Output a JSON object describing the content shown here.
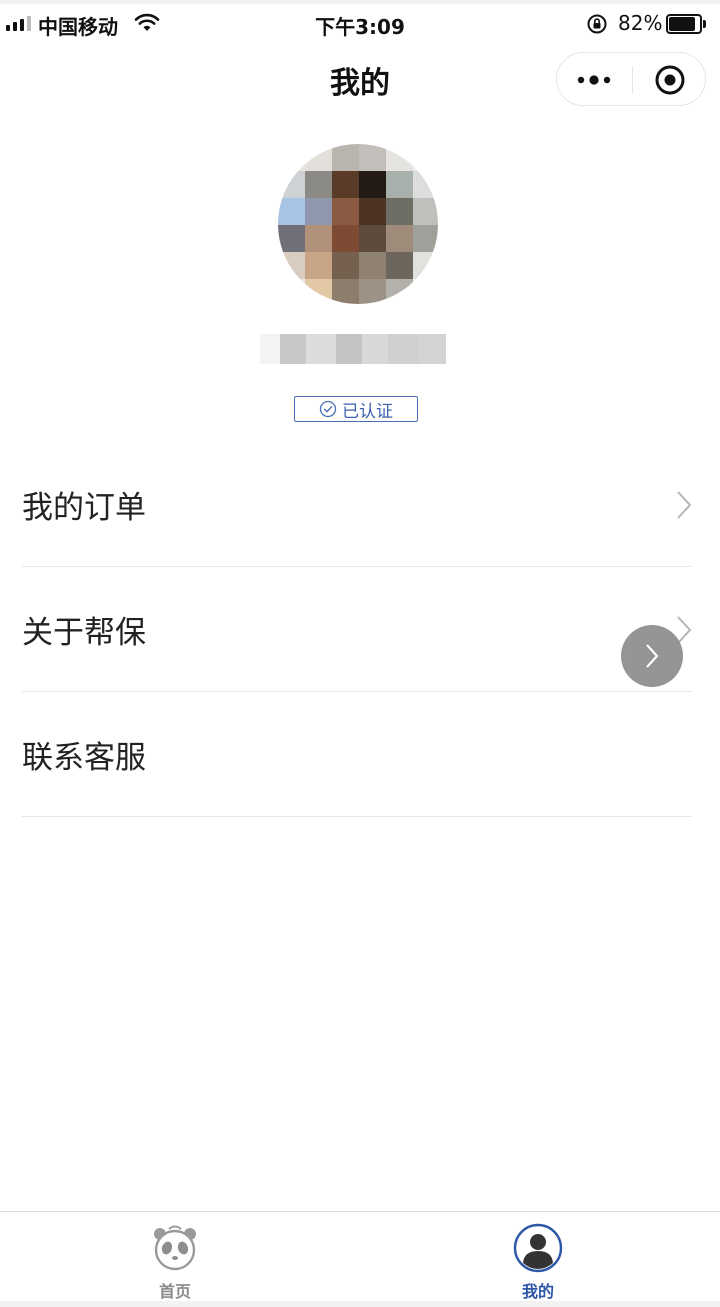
{
  "status_bar": {
    "carrier": "中国移动",
    "time": "下午3:09",
    "battery_percent": "82%"
  },
  "nav": {
    "title": "我的",
    "more_icon": "more-dots-icon",
    "close_icon": "target-circle-icon"
  },
  "profile": {
    "avatar_icon": "pixelated-avatar",
    "verified_label": "已认证"
  },
  "menu": {
    "items": [
      {
        "label": "我的订单"
      },
      {
        "label": "关于帮保"
      },
      {
        "label": "联系客服"
      }
    ]
  },
  "tabbar": {
    "tabs": [
      {
        "label": "首页",
        "icon": "panda-icon",
        "active": false
      },
      {
        "label": "我的",
        "icon": "user-icon",
        "active": true
      }
    ]
  },
  "colors": {
    "accent": "#2e57a8",
    "inactive": "#8a8a8a",
    "divider": "#e6e6e6"
  }
}
